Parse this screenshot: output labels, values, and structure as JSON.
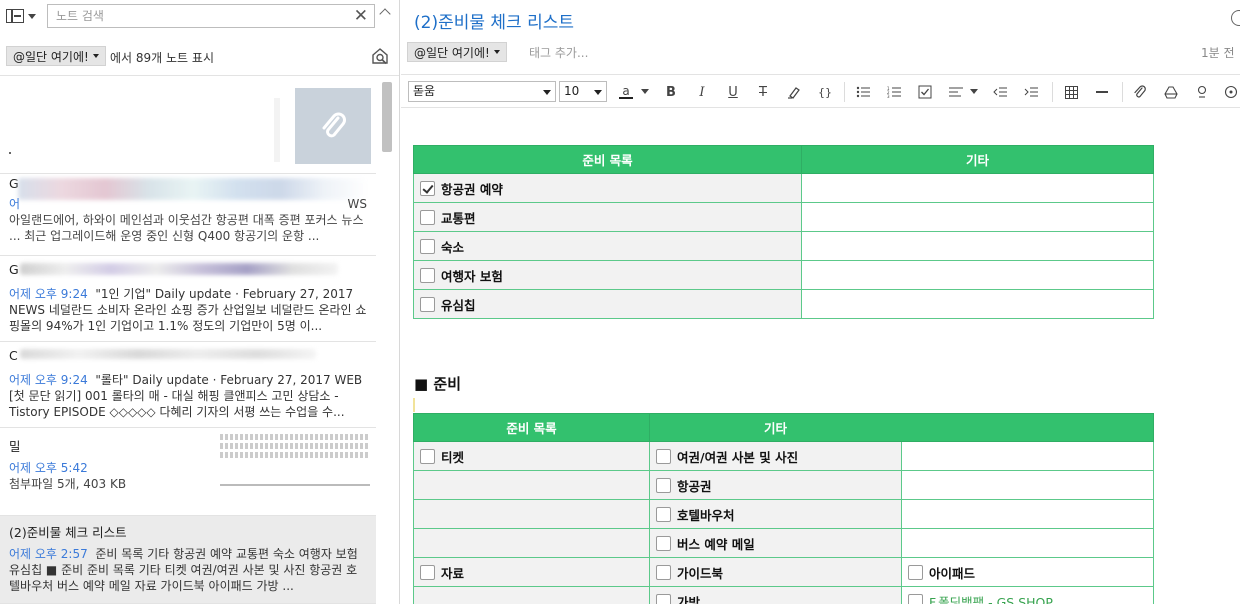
{
  "sidebar": {
    "search_placeholder": "노트 검색",
    "notebook_chip": "@일단 여기에!",
    "filter_count": "에서 89개 노트 표시",
    "notes": [
      {
        "title": "",
        "date": "",
        "snippet": "",
        "type": "attachment"
      },
      {
        "title": "G",
        "date": "어",
        "snippet": "아일랜드에어, 하와이 메인섬과 이웃섬간 항공편 대폭 증편 포커스 뉴스 ... 최근 업그레이드해 운영 중인 신형 Q400 항공기의 운항 ...",
        "tail": "WS"
      },
      {
        "title": "G",
        "date": "어제 오후 9:24",
        "snippet": "\"1인 기업\" Daily update · February 27, 2017 NEWS 네덜란드 소비자 온라인 쇼핑 증가 산업일보 네덜란드 온라인 쇼핑몰의 94%가 1인 기업이고 1.1% 정도의 기업만이 5명 이..."
      },
      {
        "title": "C",
        "date": "어제 오후 9:24",
        "snippet": "\"롤타\" Daily update · February 27, 2017 WEB [첫 문단 읽기] 001 롤타의 매 - 대실 해핑 클앤피스 고민 상담소 - Tistory EPISODE ◇◇◇◇◇ 다혜리 기자의 서평 쓰는 수업을 수..."
      },
      {
        "title": "밀",
        "date": "어제 오후 5:42",
        "snippet": "첨부파일 5개, 403 KB"
      },
      {
        "title": "(2)준비물 체크 리스트",
        "date": "어제 오후 2:57",
        "snippet": "준비 목록 기타 항공권 예약 교통편 숙소 여행자 보험 유심칩 ■ 준비 준비 목록 기타 티켓 여권/여권 사본 및 사진 항공권 호텔바우처 버스 예약 메일 자료 가이드북 아이패드 가방 ..."
      }
    ]
  },
  "editor": {
    "title": "(2)준비물 체크 리스트",
    "notebook_chip": "@일단 여기에!",
    "tag_placeholder": "태그 추가...",
    "edited": "1분 전",
    "font": "돋움",
    "size": "10",
    "table1": {
      "headers": [
        "준비 목록",
        "기타"
      ],
      "rows": [
        {
          "label": "항공권 예약",
          "checked": true
        },
        {
          "label": "교통편",
          "checked": false
        },
        {
          "label": "숙소",
          "checked": false
        },
        {
          "label": "여행자 보험",
          "checked": false
        },
        {
          "label": "유심칩",
          "checked": false
        }
      ]
    },
    "section_heading": "■ 준비",
    "table2": {
      "headers": [
        "준비 목록",
        "기타"
      ],
      "rows": [
        {
          "col1": "티켓",
          "col2": "여권/여권 사본 및 사진",
          "col3": ""
        },
        {
          "col1": "",
          "col2": "항공권",
          "col3": ""
        },
        {
          "col1": "",
          "col2": "호텔바우처",
          "col3": ""
        },
        {
          "col1": "",
          "col2": "버스 예약 메일",
          "col3": ""
        },
        {
          "col1": "자료",
          "col2": "가이드북",
          "col3": "아이패드"
        },
        {
          "col1": "",
          "col2": "가방",
          "col3": "F.폴딩백팩 - GS SHOP"
        }
      ]
    }
  },
  "colors": {
    "accent_blue": "#1e6fc8",
    "date_blue": "#3b7ad9",
    "table_green": "#33c16e",
    "selected_bg": "#ebebeb"
  }
}
